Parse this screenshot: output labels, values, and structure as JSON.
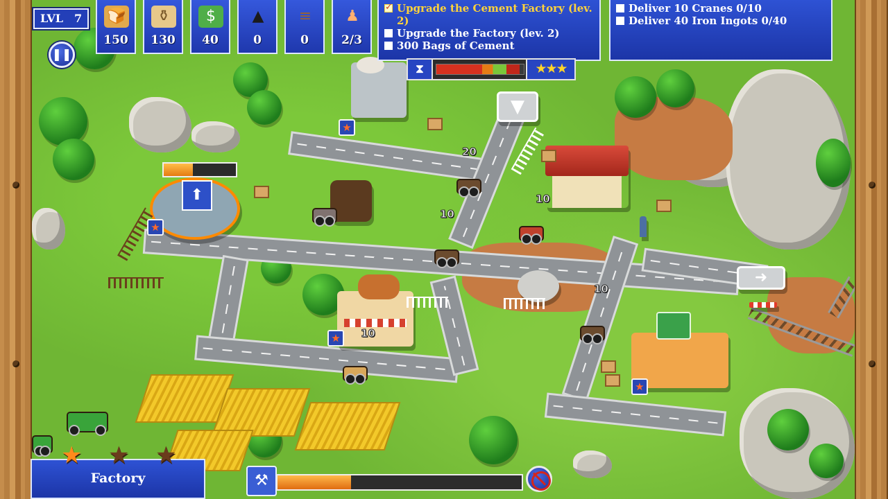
{
  "hud": {
    "level_label": "LVL",
    "level_value": "7",
    "pause_icon": "pause-icon",
    "resources": [
      {
        "name": "bread",
        "icon": "bread-icon",
        "value": "150",
        "color": "#e2a94c"
      },
      {
        "name": "flour",
        "icon": "flour-sack-icon",
        "value": "130",
        "color": "#e7c88a"
      },
      {
        "name": "money",
        "icon": "cash-stack-icon",
        "value": "40",
        "color": "#4fae48"
      },
      {
        "name": "coal",
        "icon": "coal-pile-icon",
        "value": "0",
        "color": "#2b2b2b"
      },
      {
        "name": "wood",
        "icon": "logs-icon",
        "value": "0",
        "color": "#9a6432"
      },
      {
        "name": "workers",
        "icon": "worker-icon",
        "value": "2/3",
        "color": "#444"
      }
    ]
  },
  "goals_left": [
    {
      "text": "Upgrade the Cement Factory (lev. 2)",
      "done": true
    },
    {
      "text": "Upgrade the Factory (lev. 2)",
      "done": false
    },
    {
      "text": "300 Bags of Cement",
      "done": false
    }
  ],
  "goals_right": [
    {
      "text": "Deliver 10 Cranes 0/10",
      "done": false
    },
    {
      "text": "Deliver 40 Iron Ingots 0/40",
      "done": false
    }
  ],
  "timer": {
    "progress": 0.95,
    "stars": "★★★"
  },
  "map": {
    "badges": [
      "20",
      "10",
      "10",
      "10",
      "10"
    ],
    "factory_progress": 0.4
  },
  "bottom": {
    "selected_building": "Factory",
    "upgrade_progress": 0.3,
    "rank_stars": [
      "earned",
      "empty",
      "empty"
    ]
  },
  "colors": {
    "hud_blue": "#2e52d4",
    "goal_done": "#ffd33a",
    "star_gold": "#ffd42a",
    "cancel_red": "#d5261c"
  }
}
